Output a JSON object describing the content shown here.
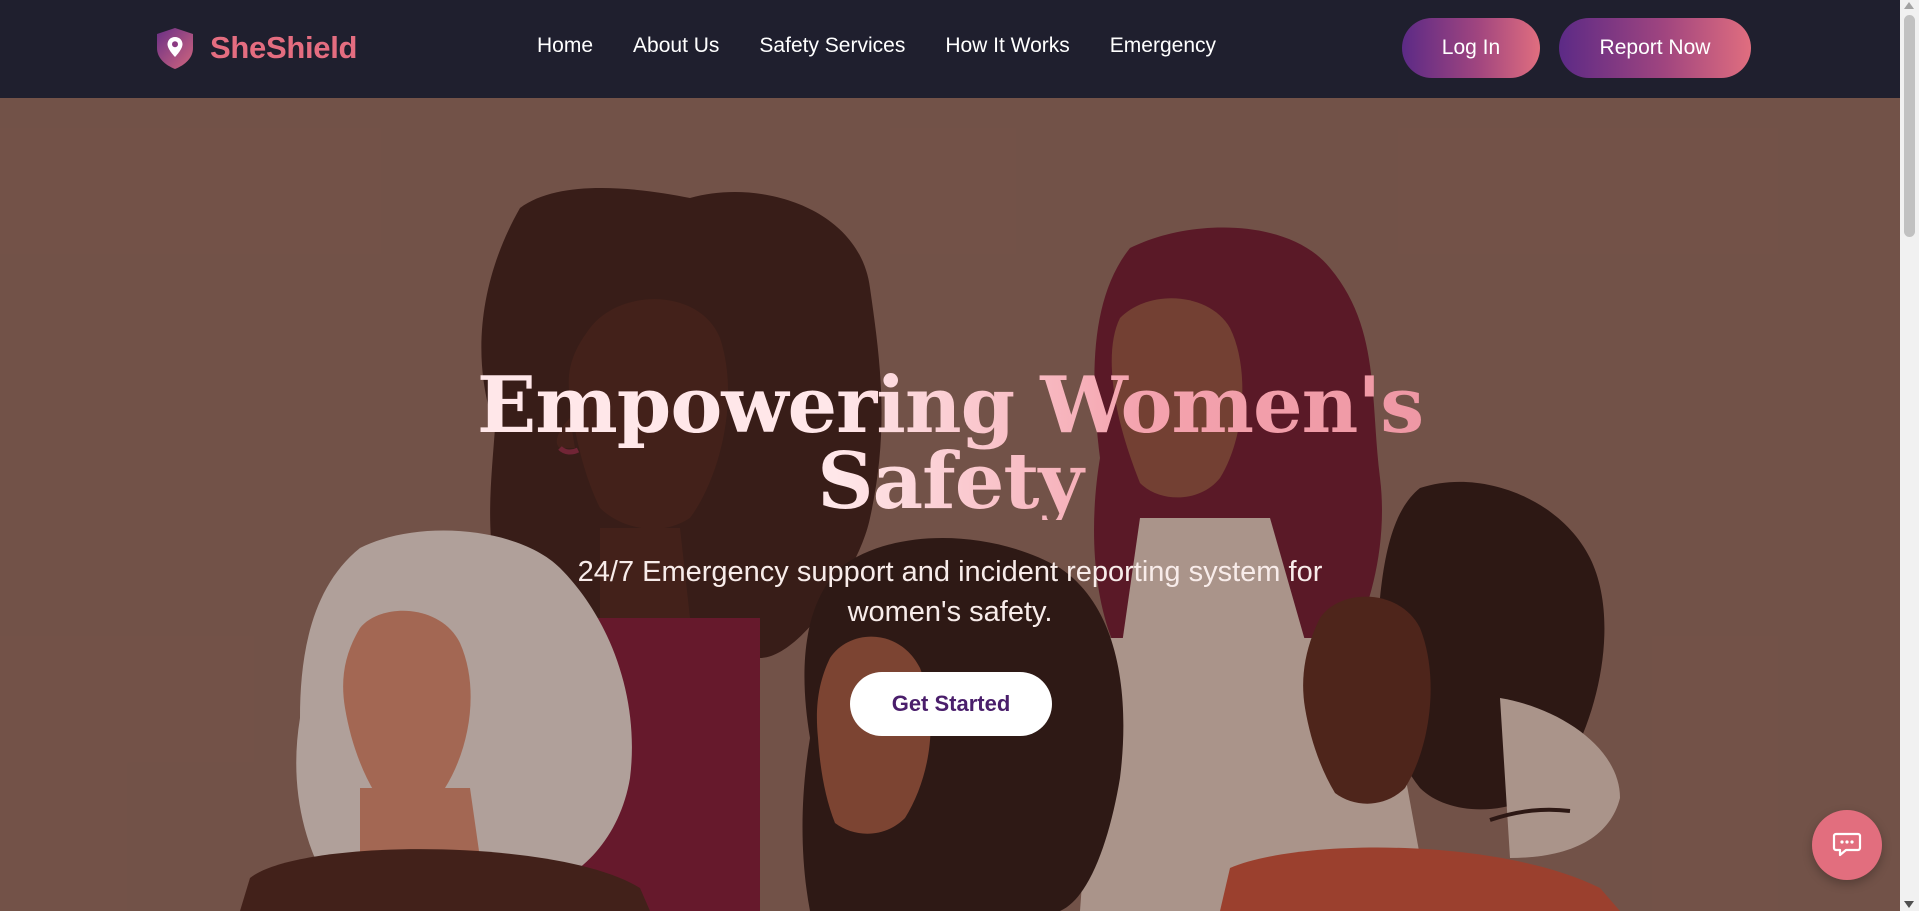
{
  "brand": {
    "name": "SheShield",
    "icon": "shield-location-icon",
    "color": "#e46d80"
  },
  "nav": {
    "links": [
      "Home",
      "About Us",
      "Safety Services",
      "How It Works",
      "Emergency"
    ],
    "login_label": "Log In",
    "report_label": "Report Now"
  },
  "hero": {
    "title_line1": "Empowering Women's",
    "title_line2": "Safety",
    "subtitle": "24/7 Emergency support and incident reporting system for women's safety.",
    "cta_label": "Get Started"
  },
  "chat": {
    "icon": "chat-bubble-icon"
  },
  "colors": {
    "navbar_bg": "#1f1f2e",
    "accent_pink": "#e46d80",
    "accent_purple": "#5c2a86",
    "cta_text": "#4a1e6b",
    "hero_bg": "#7c5d52"
  }
}
